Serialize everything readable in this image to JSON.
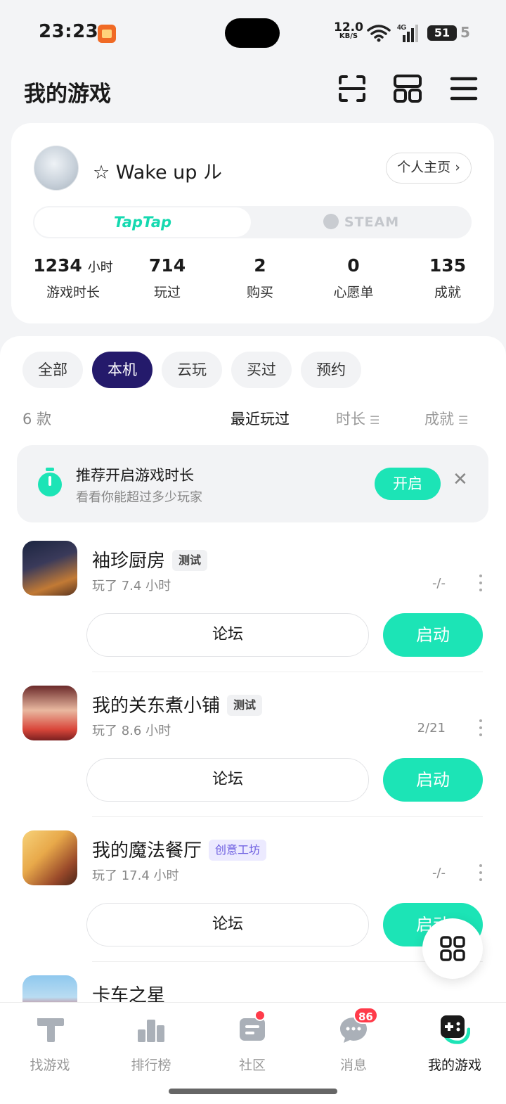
{
  "status_bar": {
    "time": "23:23",
    "net_speed": "12.0",
    "net_unit": "KB/S",
    "network": "4G",
    "battery": "51",
    "battery_rest": "5"
  },
  "header": {
    "title": "我的游戏",
    "icons": [
      "scan-icon",
      "layout-grid-icon",
      "menu-icon"
    ]
  },
  "profile": {
    "username": "☆ Wake up ル",
    "homepage_label": "个人主页 ›",
    "platforms": [
      "TapTap",
      "STEAM"
    ],
    "active_platform": "TapTap",
    "stats": [
      {
        "value": "1234",
        "unit": "小时",
        "label": "游戏时长"
      },
      {
        "value": "714",
        "unit": "",
        "label": "玩过"
      },
      {
        "value": "2",
        "unit": "",
        "label": "购买"
      },
      {
        "value": "0",
        "unit": "",
        "label": "心愿单"
      },
      {
        "value": "135",
        "unit": "",
        "label": "成就"
      }
    ]
  },
  "filters": {
    "chips": [
      "全部",
      "本机",
      "云玩",
      "买过",
      "预约"
    ],
    "active": "本机"
  },
  "list": {
    "count": "6 款",
    "sort_options": [
      "最近玩过",
      "时长",
      "成就"
    ],
    "active_sort": "最近玩过"
  },
  "banner": {
    "title": "推荐开启游戏时长",
    "subtitle": "看看你能超过多少玩家",
    "button": "开启",
    "close": "✕"
  },
  "games": [
    {
      "title": "袖珍厨房",
      "tag": "测试",
      "tag_style": "gray",
      "play_time": "玩了 7.4 小时",
      "achievements": "-/-",
      "forum": "论坛",
      "launch": "启动"
    },
    {
      "title": "我的关东煮小铺",
      "tag": "测试",
      "tag_style": "gray",
      "play_time": "玩了 8.6 小时",
      "achievements": "2/21",
      "forum": "论坛",
      "launch": "启动"
    },
    {
      "title": "我的魔法餐厅",
      "tag": "创意工坊",
      "tag_style": "purple",
      "play_time": "玩了 17.4 小时",
      "achievements": "-/-",
      "forum": "论坛",
      "launch": "启动"
    },
    {
      "title": "卡车之星"
    }
  ],
  "bottom_nav": {
    "items": [
      {
        "label": "找游戏",
        "icon": "taptap-icon"
      },
      {
        "label": "排行榜",
        "icon": "ranking-icon"
      },
      {
        "label": "社区",
        "icon": "community-icon",
        "dot": true
      },
      {
        "label": "消息",
        "icon": "message-icon",
        "badge": "86"
      },
      {
        "label": "我的游戏",
        "icon": "gamepad-icon",
        "active": true
      }
    ]
  },
  "colors": {
    "accent": "#1ce4b6",
    "active_chip": "#241a6b",
    "badge": "#ff3b4a",
    "creative_tag": "#6b5ce0"
  }
}
